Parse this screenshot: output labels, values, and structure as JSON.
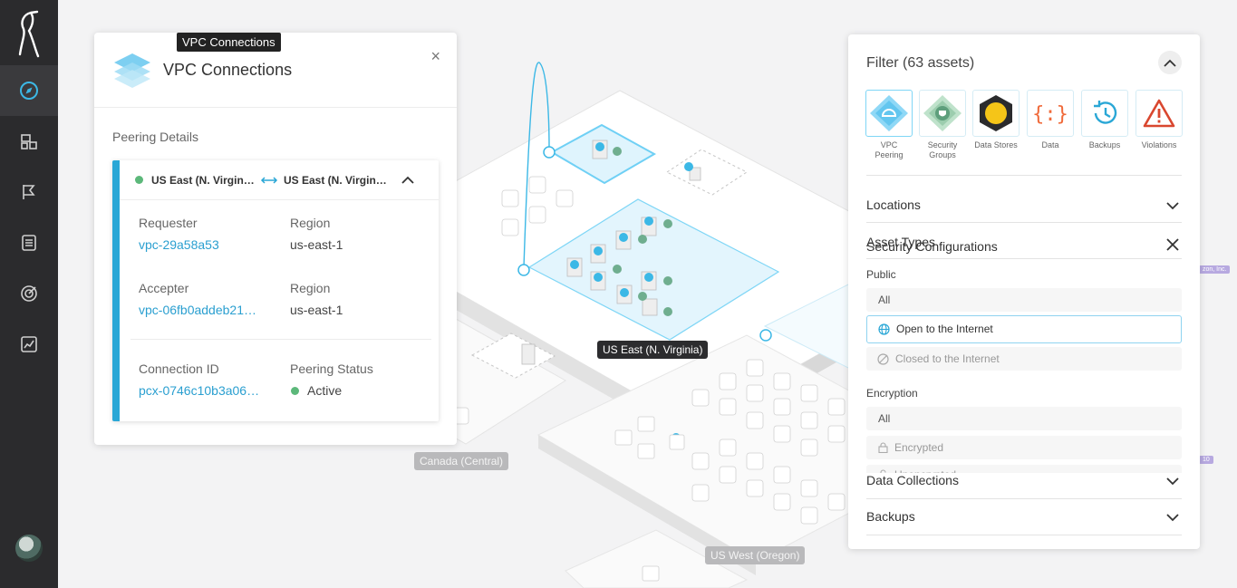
{
  "tooltip": "VPC Connections",
  "vpc_panel": {
    "title": "VPC Connections",
    "close": "×",
    "section_title": "Peering Details",
    "connection": {
      "from": "US East (N. Virgin…",
      "to": "US East (N. Virgin…",
      "requester_label": "Requester",
      "requester": "vpc-29a58a53",
      "requester_region_label": "Region",
      "requester_region": "us-east-1",
      "accepter_label": "Accepter",
      "accepter": "vpc-06fb0addeb21…",
      "accepter_region_label": "Region",
      "accepter_region": "us-east-1",
      "connection_id_label": "Connection ID",
      "connection_id": "pcx-0746c10b3a06…",
      "status_label": "Peering Status",
      "status": "Active"
    }
  },
  "map": {
    "region_us_east": "US East (N. Virginia)",
    "region_canada": "Canada (Central)",
    "region_us_west": "US West (Oregon)",
    "side_tag_1": "zon, Inc.",
    "side_tag_2": "10"
  },
  "filter": {
    "title": "Filter (63 assets)",
    "asset_types": [
      {
        "label": "VPC Peering",
        "icon": "vpc-peering-icon"
      },
      {
        "label": "Security Groups",
        "icon": "security-groups-icon"
      },
      {
        "label": "Data Stores",
        "icon": "data-stores-icon"
      },
      {
        "label": "Data",
        "icon": "data-icon"
      },
      {
        "label": "Backups",
        "icon": "backups-icon"
      },
      {
        "label": "Violations",
        "icon": "violations-icon"
      }
    ],
    "locations": "Locations",
    "asset_types_label": "Asset Types",
    "security_configurations": "Security Configurations",
    "public_label": "Public",
    "public_options": [
      "All",
      "Open to the Internet",
      "Closed to the Internet"
    ],
    "encryption_label": "Encryption",
    "encryption_options": [
      "All",
      "Encrypted",
      "Unencrypted"
    ],
    "data_collections": "Data Collections",
    "backups": "Backups"
  },
  "colors": {
    "accent": "#2aa7d6",
    "active_status": "#5cb87a",
    "sidebar": "#2b2b2d"
  }
}
